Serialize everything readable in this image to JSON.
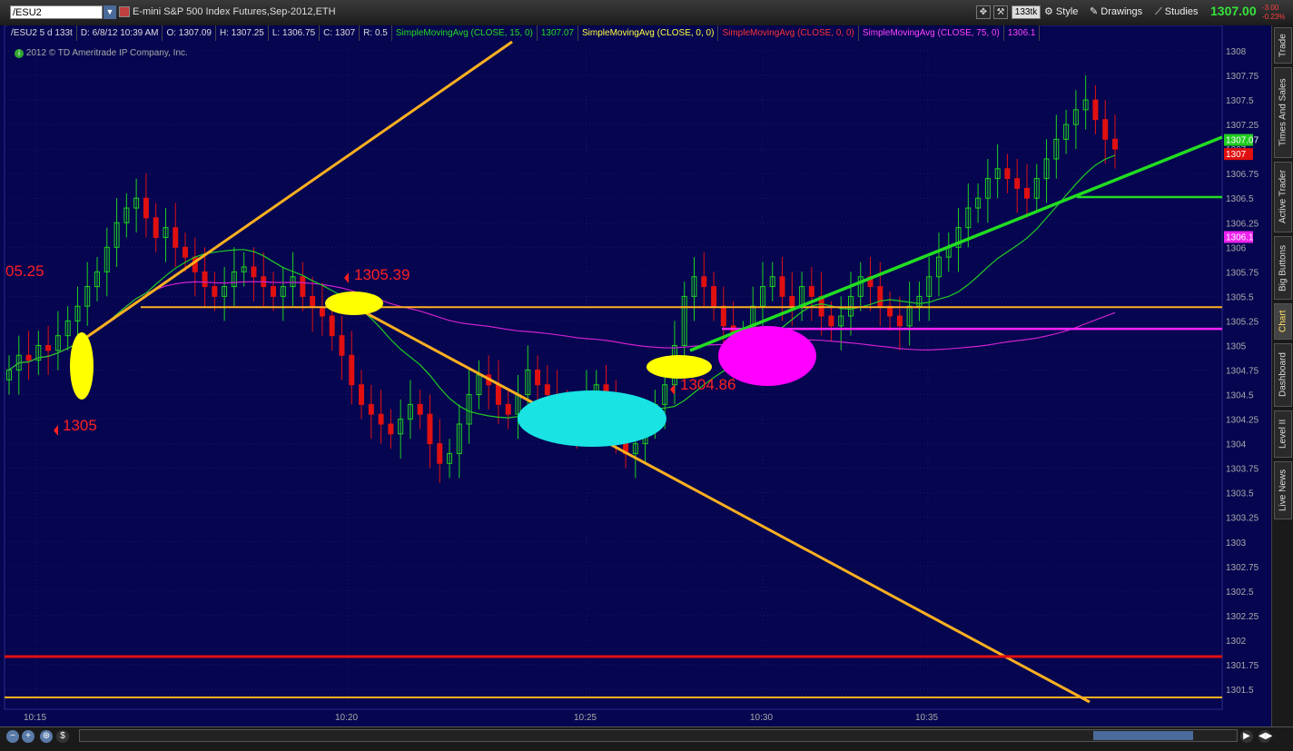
{
  "window": {
    "symbol": "/ESU2",
    "title": "E-mini S&P 500 Index Futures,Sep-2012,ETH",
    "tick_badge": "133tk",
    "style_label": "Style",
    "drawings_label": "Drawings",
    "studies_label": "Studies",
    "last_price": "1307.00",
    "change": "-3.00",
    "change_pct": "-0.23%"
  },
  "info": {
    "period": "/ESU2 5 d 133t",
    "date": "D: 6/8/12 10:39 AM",
    "open": "O: 1307.09",
    "high": "H: 1307.25",
    "low": "L: 1306.75",
    "close": "C: 1307",
    "range": "R: 0.5",
    "sma15_label": "SimpleMovingAvg (CLOSE, 15, 0)",
    "sma15_value": "1307.07",
    "sma0a_label": "SimpleMovingAvg (CLOSE, 0, 0)",
    "sma0b_label": "SimpleMovingAvg (CLOSE, 0, 0)",
    "sma75_label": "SimpleMovingAvg (CLOSE, 75, 0)",
    "sma75_value": "1306.1"
  },
  "copyright": "2012 © TD Ameritrade IP Company, Inc.",
  "colors": {
    "background": "#050550",
    "grid": "#2a2a88",
    "up": "#1fd21f",
    "down": "#e01010",
    "sma15": "#22cc22",
    "sma75": "#cc22cc",
    "orange": "#ffb020",
    "red_line": "#e01010"
  },
  "price_axis": {
    "ticks": [
      "1308",
      "1307.75",
      "1307.5",
      "1307.25",
      "1307",
      "1306.75",
      "1306.5",
      "1306.25",
      "1306",
      "1305.75",
      "1305.5",
      "1305.25",
      "1305",
      "1304.75",
      "1304.5",
      "1304.25",
      "1304",
      "1303.75",
      "1303.5",
      "1303.25",
      "1303",
      "1302.75",
      "1302.5",
      "1302.25",
      "1302",
      "1301.75",
      "1301.5"
    ],
    "badge_sma15": "1307.07",
    "badge_close": "1307",
    "badge_sma75": "1306.1"
  },
  "time_axis": {
    "labels": [
      "10:15",
      "10:20",
      "10:25",
      "10:30",
      "10:35"
    ]
  },
  "annotations": {
    "a1": "05.25",
    "a2": "1305.39",
    "a3": "1305",
    "a4": "1304.86"
  },
  "sidebar_tabs": [
    "Trade",
    "Times And Sales",
    "Active Trader",
    "Big Buttons",
    "Chart",
    "Dashboard",
    "Level II",
    "Live News"
  ],
  "active_tab": "Chart",
  "chart_data": {
    "type": "candlestick",
    "price_range": [
      1301.4,
      1308.1
    ],
    "time_labels": [
      "10:15",
      "10:20",
      "10:25",
      "10:30",
      "10:35"
    ],
    "horizontal_levels": [
      {
        "price": 1305.39,
        "color": "orange"
      },
      {
        "price": 1305.17,
        "color": "magenta"
      },
      {
        "price": 1301.9,
        "color": "red"
      },
      {
        "price": 1301.5,
        "color": "orange"
      },
      {
        "price": 1306.5,
        "color": "green"
      }
    ],
    "series": [
      {
        "name": "SimpleMovingAvg (CLOSE, 15, 0)",
        "last": 1307.07
      },
      {
        "name": "SimpleMovingAvg (CLOSE, 75, 0)",
        "last": 1306.1
      }
    ],
    "closes": [
      1304.75,
      1304.9,
      1304.85,
      1305.0,
      1304.95,
      1305.1,
      1305.25,
      1305.4,
      1305.6,
      1305.75,
      1306.0,
      1306.25,
      1306.4,
      1306.5,
      1306.3,
      1306.1,
      1306.2,
      1306.0,
      1305.9,
      1305.75,
      1305.6,
      1305.5,
      1305.6,
      1305.75,
      1305.8,
      1305.7,
      1305.6,
      1305.5,
      1305.6,
      1305.7,
      1305.5,
      1305.39,
      1305.3,
      1305.1,
      1304.9,
      1304.6,
      1304.4,
      1304.3,
      1304.2,
      1304.1,
      1304.25,
      1304.4,
      1304.3,
      1304.0,
      1303.8,
      1303.9,
      1304.2,
      1304.5,
      1304.7,
      1304.6,
      1304.4,
      1304.3,
      1304.5,
      1304.75,
      1304.6,
      1304.5,
      1304.4,
      1304.3,
      1304.2,
      1304.5,
      1304.6,
      1304.4,
      1304.1,
      1303.9,
      1304.0,
      1304.2,
      1304.4,
      1304.6,
      1305.0,
      1305.5,
      1305.7,
      1305.6,
      1305.4,
      1305.2,
      1304.86,
      1305.1,
      1305.4,
      1305.6,
      1305.7,
      1305.5,
      1305.4,
      1305.6,
      1305.5,
      1305.3,
      1305.2,
      1305.3,
      1305.5,
      1305.7,
      1305.6,
      1305.4,
      1305.3,
      1305.2,
      1305.4,
      1305.5,
      1305.7,
      1305.9,
      1306.0,
      1306.2,
      1306.4,
      1306.5,
      1306.7,
      1306.8,
      1306.7,
      1306.6,
      1306.5,
      1306.7,
      1306.9,
      1307.1,
      1307.25,
      1307.4,
      1307.5,
      1307.3,
      1307.1,
      1307.0
    ]
  }
}
